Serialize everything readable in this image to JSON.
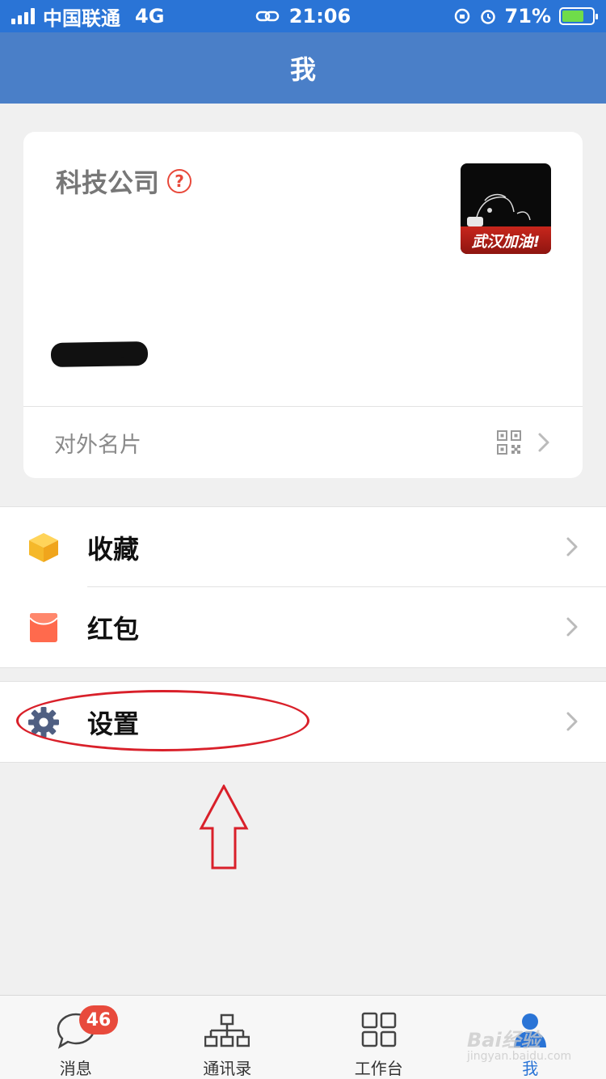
{
  "status_bar": {
    "carrier": "中国联通",
    "network": "4G",
    "time": "21:06",
    "battery_percent": "71%",
    "battery_level": 0.71
  },
  "nav": {
    "title": "我"
  },
  "profile": {
    "company": "科技公司",
    "help_icon": "?",
    "avatar_banner": "武汉加油!",
    "external_card_label": "对外名片"
  },
  "menu": {
    "favorites": "收藏",
    "red_packet": "红包",
    "settings": "设置"
  },
  "tabs": [
    {
      "label": "消息",
      "badge": "46",
      "icon": "chat-bubble-icon"
    },
    {
      "label": "通讯录",
      "icon": "org-chart-icon"
    },
    {
      "label": "工作台",
      "icon": "grid-icon"
    },
    {
      "label": "我",
      "icon": "person-icon"
    }
  ],
  "watermark": {
    "text": "Bai经验",
    "sub": "jingyan.baidu.com"
  },
  "colors": {
    "status_bar": "#2a74d6",
    "nav_bar": "#4a7fc8",
    "accent": "#2a74d6",
    "badge": "#e84a3c",
    "annotation": "#d9202a"
  }
}
